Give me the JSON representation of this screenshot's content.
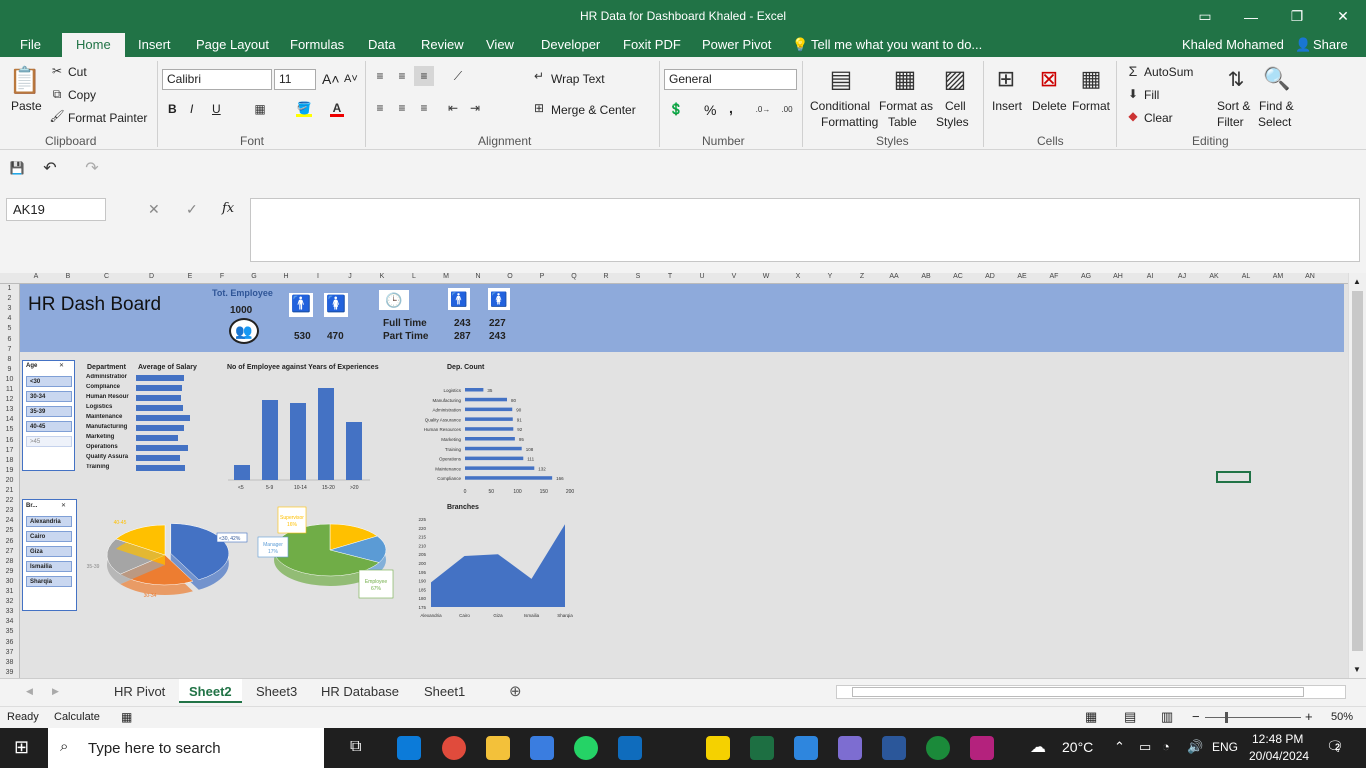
{
  "window": {
    "title": "HR Data for Dashboard Khaled - Excel"
  },
  "tabs": [
    "File",
    "Home",
    "Insert",
    "Page Layout",
    "Formulas",
    "Data",
    "Review",
    "View",
    "Developer",
    "Foxit PDF",
    "Power Pivot"
  ],
  "tell_me": "Tell me what you want to do...",
  "user": "Khaled Mohamed",
  "share": "Share",
  "ribbon": {
    "clipboard": {
      "paste": "Paste",
      "cut": "Cut",
      "copy": "Copy",
      "format_painter": "Format Painter",
      "label": "Clipboard"
    },
    "font": {
      "name": "Calibri",
      "size": "11",
      "label": "Font",
      "bold": "B",
      "italic": "I",
      "underline": "U"
    },
    "alignment": {
      "wrap": "Wrap Text",
      "merge": "Merge & Center",
      "label": "Alignment"
    },
    "number": {
      "format": "General",
      "label": "Number",
      "percent": "%",
      "comma": ","
    },
    "styles": {
      "cond": "Conditional",
      "cond2": "Formatting",
      "fmt_table": "Format as",
      "fmt_table2": "Table",
      "cell_styles": "Cell",
      "cell_styles2": "Styles",
      "label": "Styles"
    },
    "cells": {
      "insert": "Insert",
      "delete": "Delete",
      "format": "Format",
      "label": "Cells"
    },
    "editing": {
      "autosum": "AutoSum",
      "fill": "Fill",
      "clear": "Clear",
      "sort": "Sort &",
      "sort2": "Filter",
      "find": "Find &",
      "find2": "Select",
      "label": "Editing"
    }
  },
  "namebox": "AK19",
  "fx": "fx",
  "columns": [
    "A",
    "B",
    "C",
    "D",
    "E",
    "F",
    "G",
    "H",
    "I",
    "J",
    "K",
    "L",
    "M",
    "N",
    "O",
    "P",
    "Q",
    "R",
    "S",
    "T",
    "U",
    "V",
    "W",
    "X",
    "Y",
    "Z",
    "AA",
    "AB",
    "AC",
    "AD",
    "AE",
    "AF",
    "AG",
    "AH",
    "AI",
    "AJ",
    "AK",
    "AL",
    "AM",
    "AN"
  ],
  "rows": [
    "1",
    "2",
    "3",
    "4",
    "5",
    "6",
    "7",
    "8",
    "9",
    "10",
    "11",
    "12",
    "13",
    "14",
    "15",
    "16",
    "17",
    "18",
    "19",
    "20",
    "21",
    "22",
    "23",
    "24",
    "25",
    "26",
    "27",
    "28",
    "29",
    "30",
    "31",
    "32",
    "33",
    "34",
    "35",
    "36",
    "37",
    "38",
    "39"
  ],
  "dashboard": {
    "title": "HR Dash Board",
    "tot_label": "Tot. Employee",
    "total": "1000",
    "male": "530",
    "female": "470",
    "full_time": "Full Time",
    "part_time": "Part Time",
    "ft_male": "243",
    "ft_female": "227",
    "pt_male": "287",
    "pt_female": "243"
  },
  "age_slicer": {
    "title": "Age",
    "items": [
      "<30",
      "30-34",
      "35-39",
      "40-45",
      ">45"
    ]
  },
  "branch_slicer": {
    "title": "Br...",
    "items": [
      "Alexandria",
      "Cairo",
      "Giza",
      "Ismailia",
      "Sharqia"
    ]
  },
  "salary_chart": {
    "title": "Department",
    "title2": "Average of Salary",
    "departments": [
      "Administratior",
      "Compliance",
      "Human Resour",
      "Logistics",
      "Maintenance",
      "Manufacturing",
      "Marketing",
      "Operations",
      "Quality Assura",
      "Training"
    ]
  },
  "chart_data": [
    {
      "type": "bar",
      "title": "No of Employee against Years of Experiences",
      "categories": [
        "<5",
        "5-9",
        "10-14",
        "15-20",
        ">20"
      ],
      "values": [
        15,
        80,
        77,
        92,
        58
      ],
      "ylim": [
        0,
        100
      ]
    },
    {
      "type": "bar",
      "title": "Dep. Count",
      "categories": [
        "Logistics",
        "Manufacturing",
        "Administration",
        "Quality Assurance",
        "Human Resources",
        "Marketing",
        "Training",
        "Operations",
        "Maintenance",
        "Compliance"
      ],
      "values": [
        35,
        80,
        90,
        91,
        92,
        95,
        108,
        111,
        132,
        166
      ],
      "xlim": [
        0,
        200
      ],
      "ticks": [
        "0",
        "50",
        "100",
        "150",
        "200"
      ]
    },
    {
      "type": "pie",
      "slices": [
        {
          "label": "<30, 42%",
          "value": 42
        },
        {
          "label": "30-34",
          "value": 22
        },
        {
          "label": "35-39",
          "value": 20
        },
        {
          "label": "40-45",
          "value": 16
        }
      ]
    },
    {
      "type": "pie",
      "slices": [
        {
          "label": "Supervisor",
          "pct": "16%",
          "value": 16
        },
        {
          "label": "Manager",
          "pct": "17%",
          "value": 17
        },
        {
          "label": "Employee",
          "pct": "67%",
          "value": 67
        }
      ]
    },
    {
      "type": "area",
      "title": "Branches",
      "categories": [
        "Alexandria",
        "Cairo",
        "Giza",
        "Ismailia",
        "Sharqia"
      ],
      "values": [
        189,
        204,
        205,
        191,
        222
      ],
      "ylim": [
        175,
        225
      ],
      "ticks": [
        "175",
        "180",
        "185",
        "190",
        "195",
        "200",
        "205",
        "210",
        "215",
        "220",
        "225"
      ]
    }
  ],
  "sheet_tabs": [
    "HR Pivot",
    "Sheet2",
    "Sheet3",
    "HR Database",
    "Sheet1"
  ],
  "status": {
    "ready": "Ready",
    "calculate": "Calculate",
    "zoom": "50%"
  },
  "taskbar": {
    "search": "Type here to search",
    "temp": "20°C",
    "lang": "ENG",
    "time": "12:48 PM",
    "date": "20/04/2024",
    "notif": "2"
  },
  "colors": {
    "excel_green": "#217346",
    "banner": "#8eaadb",
    "bar": "#4472c4"
  }
}
